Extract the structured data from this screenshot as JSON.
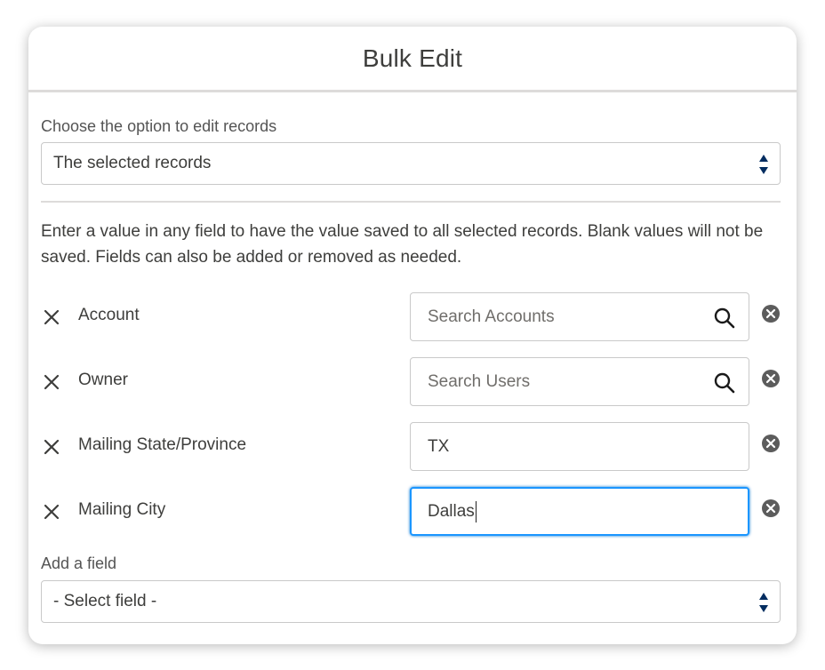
{
  "modal": {
    "title": "Bulk Edit"
  },
  "edit_option": {
    "label": "Choose the option to edit records",
    "selected": "The selected records"
  },
  "instructions": "Enter a value in any field to have the value saved to all selected records. Blank values will not be saved. Fields can also be added or removed as needed.",
  "fields": [
    {
      "label": "Account",
      "value": "",
      "placeholder": "Search Accounts",
      "type": "lookup"
    },
    {
      "label": "Owner",
      "value": "",
      "placeholder": "Search Users",
      "type": "lookup"
    },
    {
      "label": "Mailing State/Province",
      "value": "TX",
      "placeholder": "",
      "type": "text"
    },
    {
      "label": "Mailing City",
      "value": "Dallas",
      "placeholder": "",
      "type": "text",
      "focused": true
    }
  ],
  "add_field": {
    "label": "Add a field",
    "selected": "- Select field -"
  },
  "icons": {
    "remove": "close-icon",
    "search": "search-icon",
    "clear": "clear-circle-icon",
    "select_arrows": "up-down-arrows-icon"
  },
  "colors": {
    "focus_border": "#1b96ff",
    "arrow": "#032d60"
  }
}
